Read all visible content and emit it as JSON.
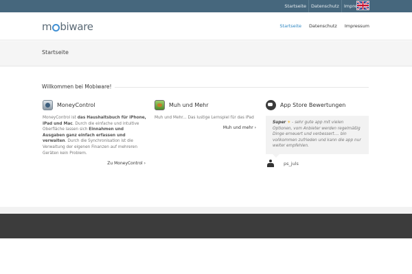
{
  "topbar": {
    "links": [
      "Startseite",
      "Datenschutz",
      "Impressum"
    ],
    "language_flag_icon": "uk-flag-icon"
  },
  "header": {
    "logo": {
      "pre": "m",
      "post": "biware"
    },
    "nav": [
      "Startseite",
      "Datenschutz",
      "Impressum"
    ],
    "active_index": 0,
    "accent": "#2e86c1"
  },
  "page": {
    "title": "Startseite",
    "welcome": "Willkommen bei Mobiware!"
  },
  "columns": {
    "money": {
      "title": "MoneyControl",
      "icon": "moneycontrol-app-icon",
      "text": [
        {
          "t": "MoneyControl ist ",
          "b": false
        },
        {
          "t": "das Haushaltsbuch für iPhone, iPad und Mac",
          "b": true
        },
        {
          "t": ". Durch die einfache und intuitive Oberfläche lassen sich ",
          "b": false
        },
        {
          "t": "Einnahmen und Ausgaben ganz einfach erfassen und verwalten",
          "b": true
        },
        {
          "t": ". Durch die Synchronisation ist die Verwaltung der eigenen Finanzen auf mehreren Geräten kein Problem.",
          "b": false
        }
      ],
      "link": "Zu MoneyControl ›"
    },
    "muh": {
      "title": "Muh und Mehr",
      "icon": "muh-und-mehr-app-icon",
      "text": "Muh und Mehr... Das lustige Lernspiel für das iPad",
      "link": "Muh und mehr ›"
    },
    "reviews": {
      "title": "App Store Bewertungen",
      "icon": "speech-bubble-icon",
      "quote_bold": "Super",
      "quote_sun": "☀",
      "quote_text": " - sehr gute app mit vielen Optionen, vom Anbieter werden regelmäßig Dinge erneuert und verbessert.... bin vollkommen zufrieden und kann die app nur weiter empfehlen.",
      "reviewer": "ps_juls",
      "reviewer_icon": "user-icon"
    }
  },
  "colors": {
    "topbar": "#46677d",
    "logo_o": "#3f8fd3",
    "band": "#f5f5f5",
    "footer": "#3c3c3c"
  }
}
